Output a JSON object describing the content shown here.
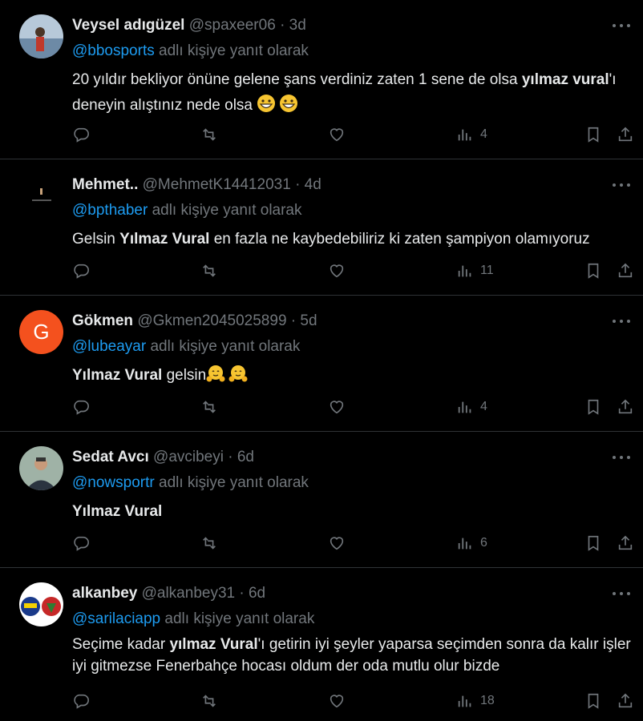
{
  "reply_suffix": "adlı kişiye yanıt olarak",
  "tweets": [
    {
      "name": "Veysel adıgüzel",
      "handle": "@spaxeer06",
      "time": "3d",
      "mention": "@bbosports",
      "text_a": "20 yıldır bekliyor önüne gelene şans verdiniz zaten 1 sene de olsa ",
      "text_b": "yılmaz vural",
      "text_c": "'ı deneyin alıştınız  nede olsa ",
      "emoji": "grinning-face",
      "views": "4"
    },
    {
      "name": "Mehmet..",
      "handle": "@MehmetK14412031",
      "time": "4d",
      "mention": "@bpthaber",
      "text_a": "Gelsin ",
      "text_b": "Yılmaz Vural",
      "text_c": " en fazla ne kaybedebiliriz ki zaten şampiyon olamıyoruz",
      "views": "11"
    },
    {
      "name": "Gökmen",
      "handle": "@Gkmen2045025899",
      "time": "5d",
      "mention": "@lubeayar",
      "avatar_letter": "G",
      "text_a": "",
      "text_b": "Yılmaz Vural",
      "text_c": " gelsin",
      "emoji": "hugging-face",
      "views": "4"
    },
    {
      "name": "Sedat Avcı",
      "handle": "@avcibeyi",
      "time": "6d",
      "mention": "@nowsportr",
      "text_a": "",
      "text_b": "Yılmaz Vural",
      "text_c": "",
      "views": "6"
    },
    {
      "name": "alkanbey",
      "handle": "@alkanbey31",
      "time": "6d",
      "mention": "@sarilaciapp",
      "text_a": "Seçime kadar ",
      "text_b": "yılmaz Vural",
      "text_c": "'ı getirin iyi şeyler yaparsa seçimden sonra da kalır işler iyi gitmezse Fenerbahçe hocası oldum der oda mutlu olur bizde",
      "views": "18"
    }
  ],
  "colors": {
    "accent": "#1d9bf0",
    "muted": "#71767b",
    "text": "#e7e9ea",
    "avatar_g": "#f4511e"
  }
}
